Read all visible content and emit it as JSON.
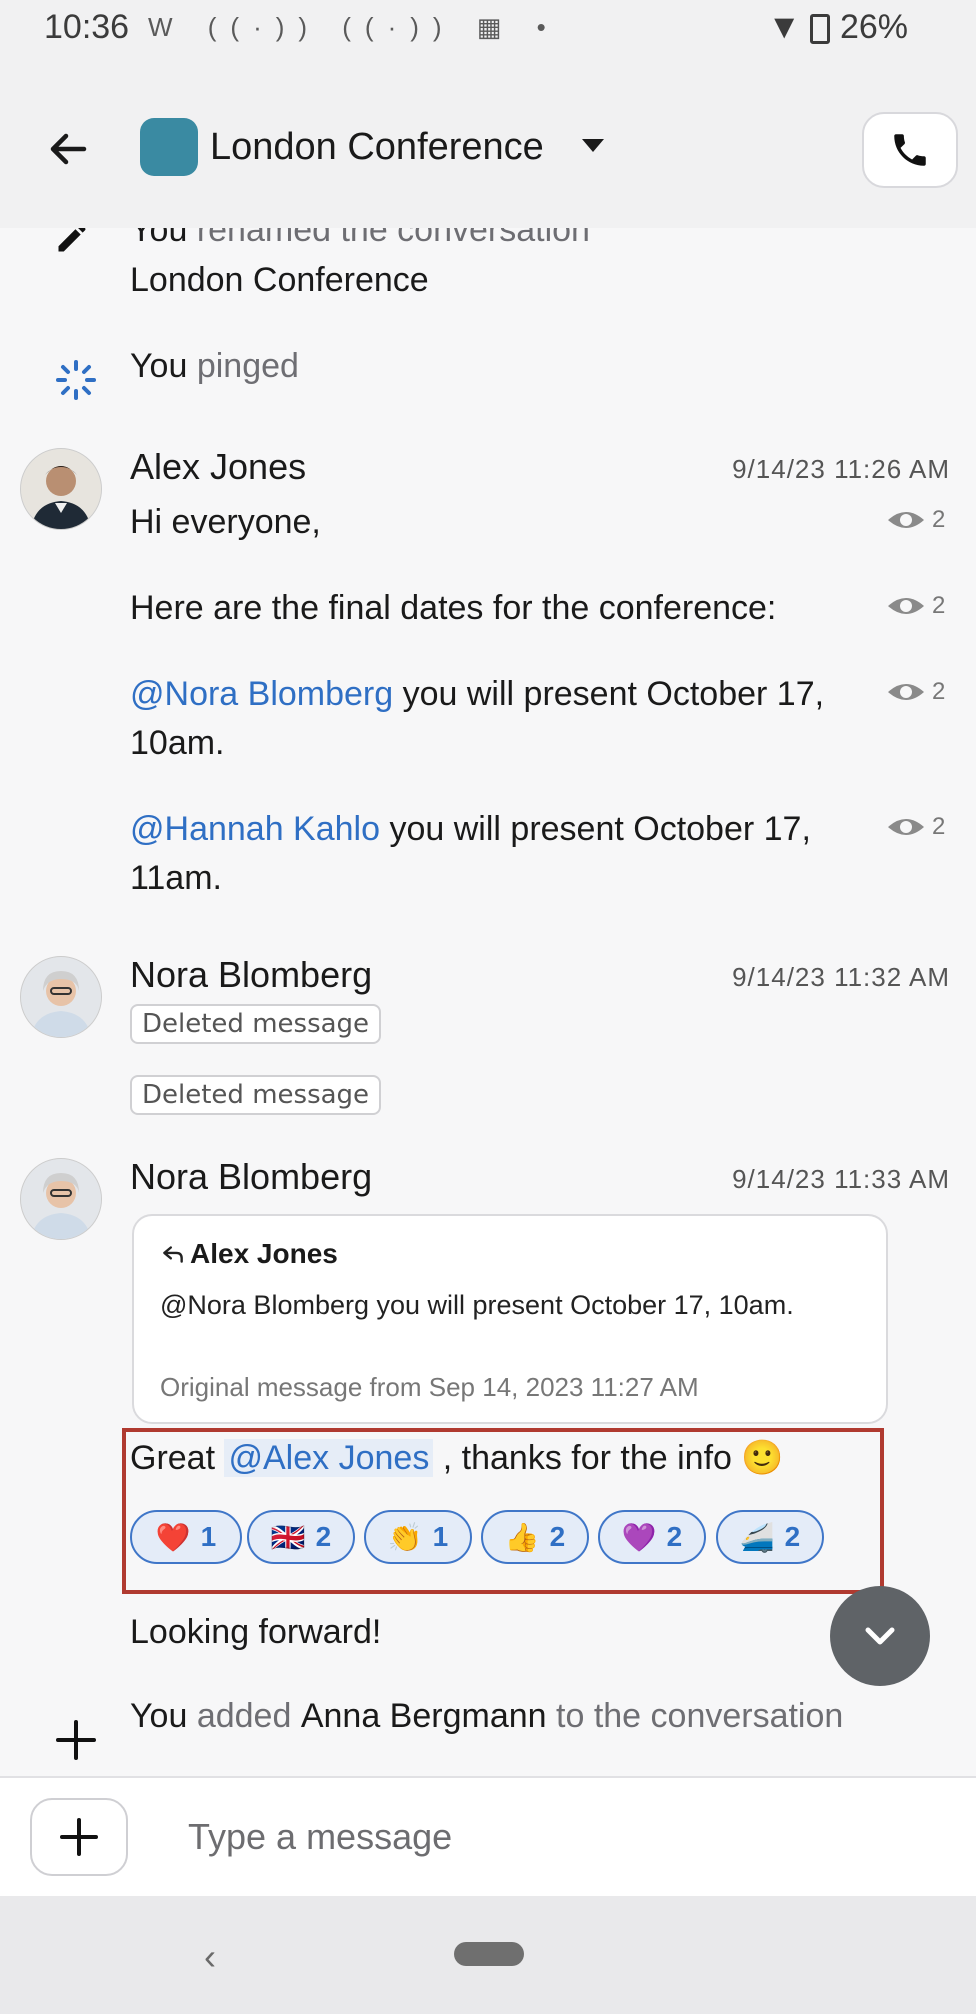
{
  "status_bar": {
    "time": "10:36",
    "icons": [
      "W",
      "((·))",
      "((·))",
      "calendar-icon",
      "•"
    ],
    "battery": "26%"
  },
  "header": {
    "title": "London Conference",
    "avatar_color": "#3a8aa2"
  },
  "system_events": {
    "rename": {
      "actor": "You",
      "text": "renamed the conversation",
      "new_name": "London Conference"
    },
    "ping": {
      "actor": "You",
      "text": "pinged"
    },
    "added": {
      "actor": "You",
      "text_before": "added",
      "person": "Anna Bergmann",
      "text_after": "to the conversation"
    }
  },
  "messages": [
    {
      "author": "Alex Jones",
      "timestamp": "9/14/23 11:26 AM",
      "parts": [
        {
          "text": "Hi everyone,",
          "read_count": "2"
        },
        {
          "text": "Here are the final dates for the conference:",
          "read_count": "2"
        },
        {
          "mention": "@Nora Blomberg",
          "text_after": " you will present October 17, 10am.",
          "read_count": "2"
        },
        {
          "mention": "@Hannah Kahlo",
          "text_after": " you will present October 17, 11am.",
          "read_count": "2"
        }
      ]
    },
    {
      "author": "Nora Blomberg",
      "timestamp": "9/14/23 11:32 AM",
      "deleted": [
        "Deleted message",
        "Deleted message"
      ]
    },
    {
      "author": "Nora Blomberg",
      "timestamp": "9/14/23 11:33 AM",
      "quote": {
        "author": "Alex Jones",
        "text": "@Nora Blomberg you will present October 17, 10am.",
        "original": "Original message from Sep 14, 2023 11:27 AM"
      },
      "text_before": "Great ",
      "mention": "@Alex Jones",
      "text_after": " , thanks for the info 🙂",
      "reactions": [
        {
          "emoji": "❤️",
          "count": "1"
        },
        {
          "emoji": "🇬🇧",
          "count": "2"
        },
        {
          "emoji": "👏",
          "count": "1"
        },
        {
          "emoji": "👍",
          "count": "2"
        },
        {
          "emoji": "💜",
          "count": "2"
        },
        {
          "emoji": "🚄",
          "count": "2"
        }
      ],
      "followup": "Looking forward!"
    }
  ],
  "composer": {
    "placeholder": "Type a message"
  },
  "colors": {
    "mention": "#2f6fc4",
    "reaction_border": "#3f76c8",
    "highlight": "#b03a30"
  }
}
